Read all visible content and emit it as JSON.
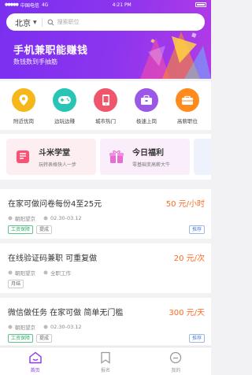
{
  "status_bar": {
    "carrier": "中国电信",
    "network": "4G",
    "time": "4:21 PM"
  },
  "search": {
    "city": "北京",
    "placeholder": "搜索职位"
  },
  "banner": {
    "title": "手机兼职能赚钱",
    "subtitle": "数钱数到手抽筋"
  },
  "categories": [
    {
      "label": "附近优岗",
      "icon": "location-pin-icon",
      "color": "#f5b719"
    },
    {
      "label": "边玩边赚",
      "icon": "gamepad-icon",
      "color": "#28c5b6"
    },
    {
      "label": "城市热门",
      "icon": "phone-icon",
      "color": "#f0566b"
    },
    {
      "label": "极速上岗",
      "icon": "briefcase-icon",
      "color": "#9a57e8"
    },
    {
      "label": "高薪职位",
      "icon": "toolbox-icon",
      "color": "#ff8a1d"
    }
  ],
  "promos": [
    {
      "title": "斗米学堂",
      "subtitle": "玩转表格快人一步",
      "icon": "book-icon",
      "color": "#ff4f73"
    },
    {
      "title": "今日福利",
      "subtitle": "零基础变高薪大牛",
      "icon": "gift-icon",
      "color": "#e86ad4"
    }
  ],
  "jobs": [
    {
      "title": "在家可做问卷每份4至25元",
      "pay": "50 元/小时",
      "location": "朝阳望京",
      "date": "02.30-03.12",
      "tags": [
        "工资保障",
        "提成"
      ],
      "badge": "推荐"
    },
    {
      "title": "在线验证码兼职 可重复做",
      "pay": "20 元/次",
      "location": "朝阳望京",
      "date": "全职工作",
      "tags": [
        "月结"
      ],
      "badge": ""
    },
    {
      "title": "微信做任务 在家可做 简单无门槛",
      "pay": "300 元/天",
      "location": "朝阳望京",
      "date": "02.30-03.12",
      "tags": [
        "工资保障",
        "提成"
      ],
      "badge": "推荐"
    }
  ],
  "tabbar": [
    {
      "label": "首页",
      "icon": "home-icon",
      "active": true
    },
    {
      "label": "报名",
      "icon": "bookmark-icon",
      "active": false
    },
    {
      "label": "我的",
      "icon": "profile-icon",
      "active": false
    }
  ],
  "colors": {
    "brand": "#8a36ee",
    "pay": "#ff6a1f"
  }
}
